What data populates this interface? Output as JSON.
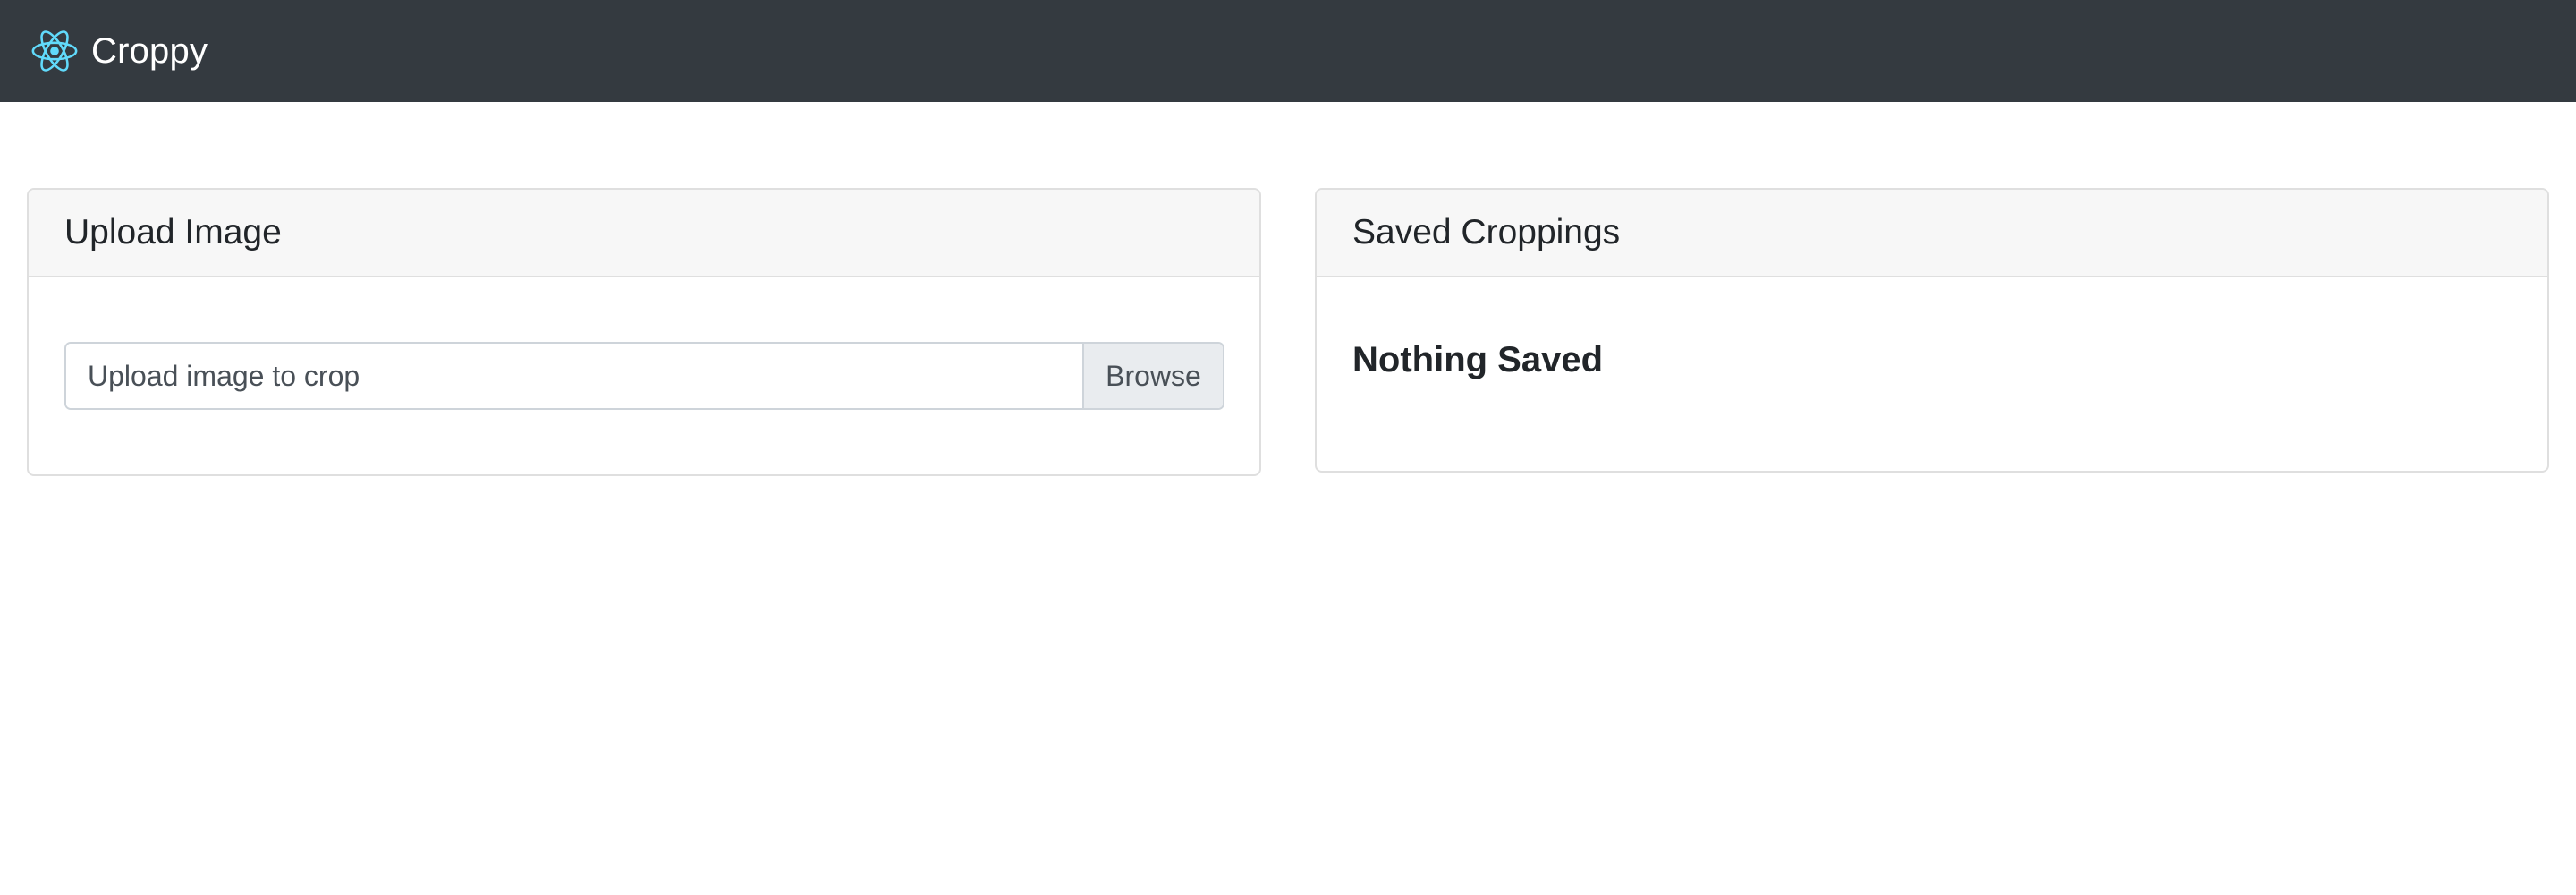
{
  "navbar": {
    "brand_label": "Croppy",
    "logo_icon": "react-atom-icon",
    "logo_color": "#61dafb",
    "background": "#343a40"
  },
  "upload_card": {
    "title": "Upload Image",
    "input_placeholder": "Upload image to crop",
    "browse_label": "Browse"
  },
  "saved_card": {
    "title": "Saved Croppings",
    "empty_message": "Nothing Saved"
  }
}
